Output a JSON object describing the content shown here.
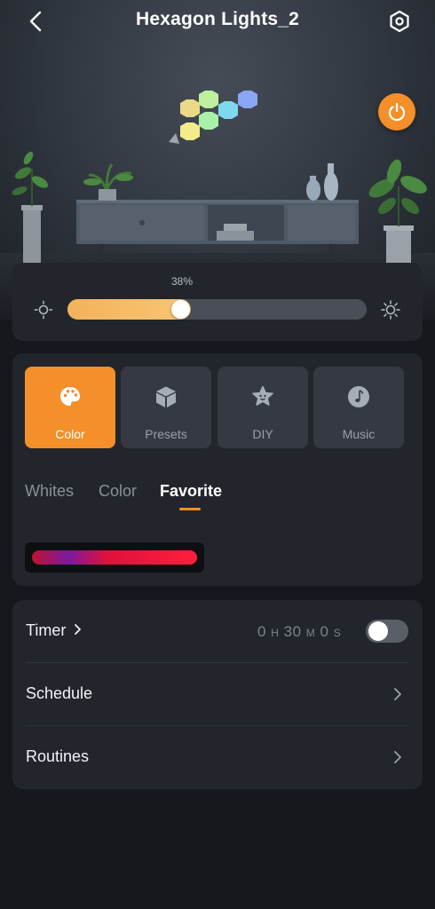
{
  "header": {
    "title": "Hexagon Lights_2"
  },
  "brightness": {
    "percent_label": "38%",
    "value_fraction": 0.38
  },
  "modes": [
    {
      "label": "Color",
      "icon": "palette-icon",
      "active": true
    },
    {
      "label": "Presets",
      "icon": "cube-icon",
      "active": false
    },
    {
      "label": "DIY",
      "icon": "star-icon",
      "active": false
    },
    {
      "label": "Music",
      "icon": "music-note-icon",
      "active": false
    }
  ],
  "subtabs": [
    {
      "label": "Whites",
      "active": false
    },
    {
      "label": "Color",
      "active": false
    },
    {
      "label": "Favorite",
      "active": true
    }
  ],
  "favorite": {
    "gradient_colors": [
      "#c0122f",
      "#7a1aa0",
      "#e0103a",
      "#ff1f3d"
    ]
  },
  "settings": {
    "timer": {
      "label": "Timer",
      "hours": "0",
      "h_unit": "H",
      "minutes": "30",
      "m_unit": "M",
      "seconds": "0",
      "s_unit": "S",
      "enabled": false
    },
    "schedule": {
      "label": "Schedule"
    },
    "routines": {
      "label": "Routines"
    }
  },
  "colors": {
    "accent": "#f48f2a",
    "background": "#15181c",
    "card": "#22262c"
  }
}
